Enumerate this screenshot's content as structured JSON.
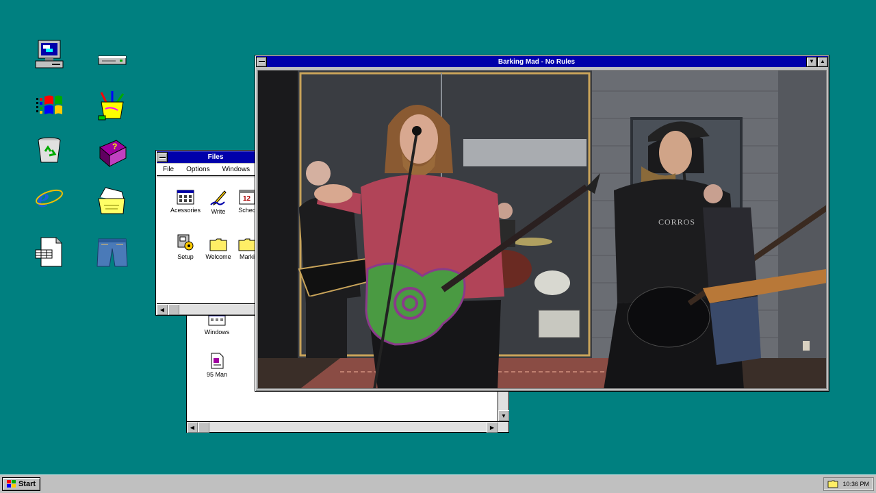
{
  "desktop": {
    "background_color": "#008080",
    "icons": [
      "my-computer",
      "drive",
      "windows-logo",
      "paint-cup",
      "recycle-bin",
      "help-book",
      "internet-explorer",
      "briefcase-folder",
      "document-with-table",
      "jeans"
    ]
  },
  "files_window": {
    "title": "Files",
    "menu": [
      "File",
      "Options",
      "Windows"
    ],
    "items": [
      {
        "label": "Acessories",
        "icon": "accessories-icon"
      },
      {
        "label": "Write",
        "icon": "write-icon"
      },
      {
        "label": "Sched",
        "icon": "schedule-icon"
      },
      {
        "label": "Setup",
        "icon": "setup-icon"
      },
      {
        "label": "Welcome",
        "icon": "folder-icon"
      },
      {
        "label": "Marki",
        "icon": "folder-icon"
      }
    ]
  },
  "files_back_window": {
    "items": [
      {
        "label": "Windows",
        "icon": "windows-group-icon"
      },
      {
        "label": "95 Man",
        "icon": "document-icon"
      }
    ]
  },
  "video_window": {
    "title": "Barking Mad - No Rules"
  },
  "taskbar": {
    "start_label": "Start",
    "clock": "10:36 PM"
  }
}
